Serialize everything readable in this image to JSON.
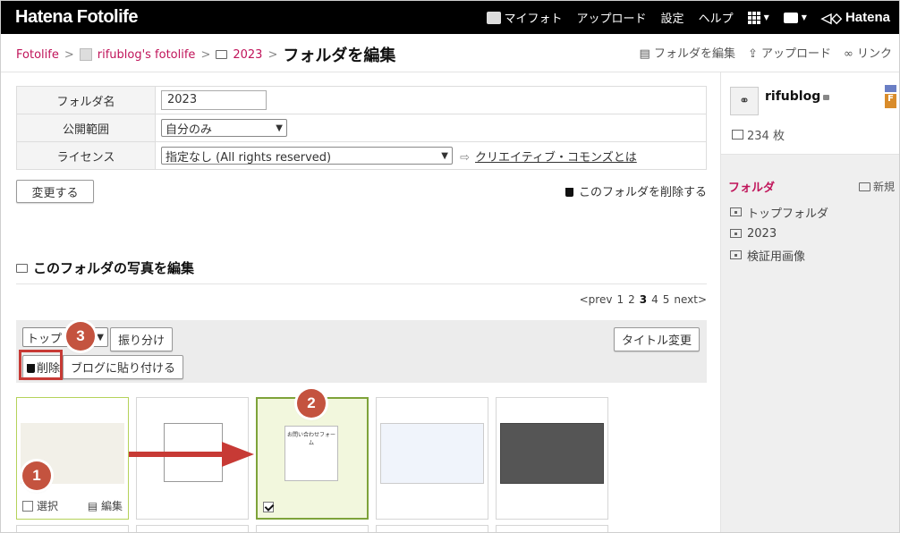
{
  "header": {
    "brand": "Hatena Fotolife",
    "nav": {
      "myfoto": "マイフォト",
      "upload": "アップロード",
      "settings": "設定",
      "help": "ヘルプ",
      "hatena": "Hatena"
    }
  },
  "breadcrumb": {
    "root": "Fotolife",
    "user": "rifublog's fotolife",
    "folder": "2023",
    "current": "フォルダを編集",
    "sep": ">"
  },
  "crumb_actions": {
    "edit_folder": "フォルダを編集",
    "upload": "アップロード",
    "link": "リンク"
  },
  "form": {
    "folder_name_label": "フォルダ名",
    "folder_name_value": "2023",
    "visibility_label": "公開範囲",
    "visibility_value": "自分のみ",
    "license_label": "ライセンス",
    "license_value": "指定なし (All rights reserved)",
    "cc_link": "クリエイティブ・コモンズとは",
    "change_button": "変更する",
    "delete_folder": "このフォルダを削除する"
  },
  "photos": {
    "heading": "このフォルダの写真を編集",
    "pager": {
      "prev": "<prev",
      "pages": [
        "1",
        "2",
        "3",
        "4",
        "5"
      ],
      "current": "3",
      "next": "next>"
    },
    "toolbar": {
      "select_value": "トップ",
      "sort_button": "振り分け",
      "title_change": "タイトル変更",
      "delete_button": "削除",
      "paste_button": "ブログに貼り付ける"
    },
    "thumb_select": "選択",
    "thumb_edit": "編集",
    "thumbs": [
      {
        "caption": ""
      },
      {
        "caption": ""
      },
      {
        "caption": "お問い合わせフォーム"
      },
      {
        "caption": ""
      },
      {
        "caption": ""
      }
    ]
  },
  "annotations": {
    "badges": [
      "1",
      "2",
      "3"
    ],
    "accent": "#c4533f"
  },
  "sidebar": {
    "user": "rifublog",
    "medal": "F",
    "count": "234 枚",
    "folders_heading": "フォルダ",
    "new_label": "新規",
    "folders": [
      "トップフォルダ",
      "2023",
      "検証用画像"
    ]
  },
  "colors": {
    "topbar": "#000000",
    "link": "#c0145a",
    "selected_border": "#7ea33a"
  }
}
